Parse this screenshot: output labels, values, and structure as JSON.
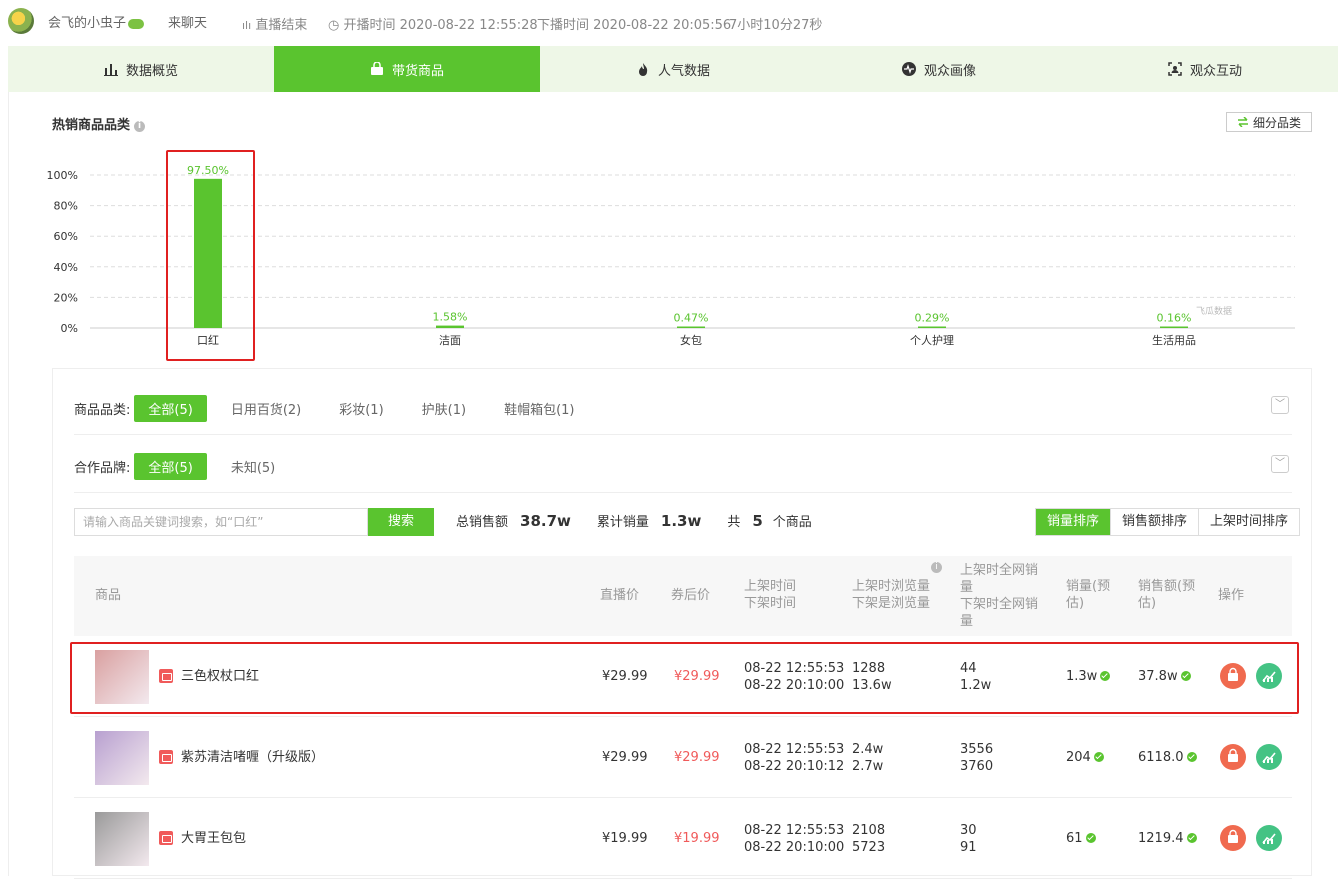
{
  "header": {
    "anchor_name": "会飞的小虫子",
    "chat_label": "来聊天",
    "live_status": "直播结束",
    "start_time": "开播时间 2020-08-22 12:55:28",
    "end_time": "下播时间 2020-08-22 20:05:56",
    "duration": "7小时10分27秒"
  },
  "tabs": [
    {
      "label": "数据概览",
      "icon": "bar-chart-icon",
      "active": false
    },
    {
      "label": "带货商品",
      "icon": "shopping-bag-icon",
      "active": true
    },
    {
      "label": "人气数据",
      "icon": "flame-icon",
      "active": false
    },
    {
      "label": "观众画像",
      "icon": "pulse-icon",
      "active": false
    },
    {
      "label": "观众互动",
      "icon": "face-scan-icon",
      "active": false
    }
  ],
  "category_section": {
    "title": "热销商品品类",
    "subcategory_button": "细分品类"
  },
  "watermark": "飞瓜数据",
  "chart_data": {
    "type": "bar",
    "title": "",
    "categories": [
      "口红",
      "洁面",
      "女包",
      "个人护理",
      "生活用品"
    ],
    "values": [
      97.5,
      1.58,
      0.47,
      0.29,
      0.16
    ],
    "value_labels": [
      "97.50%",
      "1.58%",
      "0.47%",
      "0.29%",
      "0.16%"
    ],
    "yticks": [
      "0%",
      "20%",
      "40%",
      "60%",
      "80%",
      "100%"
    ],
    "ylim": [
      0,
      100
    ],
    "grid": true,
    "color": "#5ac42f",
    "label_color": "#5ac42f"
  },
  "filters": {
    "category_label": "商品品类:",
    "category_chips": [
      "全部(5)",
      "日用百货(2)",
      "彩妆(1)",
      "护肤(1)",
      "鞋帽箱包(1)"
    ],
    "brand_label": "合作品牌:",
    "brand_chips": [
      "全部(5)",
      "未知(5)"
    ]
  },
  "search": {
    "placeholder": "请输入商品关键词搜索，如“口红”",
    "button": "搜索"
  },
  "stats": {
    "total_sales_label": "总销售额",
    "total_sales": "38.7w",
    "cum_volume_label": "累计销量",
    "cum_volume": "1.3w",
    "count_prefix": "共",
    "count": "5",
    "count_suffix": "个商品"
  },
  "sort": [
    "销量排序",
    "销售额排序",
    "上架时间排序"
  ],
  "table": {
    "headers": {
      "product": "商品",
      "live_price": "直播价",
      "coupon_price": "券后价",
      "shelf_time_1": "上架时间",
      "shelf_time_2": "下架时间",
      "views_1": "上架时浏览量",
      "views_2": "下架是浏览量",
      "net_sales_1": "上架时全网销量",
      "net_sales_2": "下架时全网销量",
      "volume": "销量(预估)",
      "revenue": "销售额(预估)",
      "ops": "操作"
    },
    "rows": [
      {
        "name": "三色权杖口红",
        "live_price": "¥29.99",
        "coupon_price": "¥29.99",
        "on_time": "08-22 12:55:53",
        "off_time": "08-22 20:10:00",
        "views_on": "1288",
        "views_off": "13.6w",
        "net_on": "44",
        "net_off": "1.2w",
        "volume": "1.3w",
        "revenue": "37.8w",
        "thumb_color": "#d9a0a0"
      },
      {
        "name": "紫苏清洁啫喱（升级版）",
        "live_price": "¥29.99",
        "coupon_price": "¥29.99",
        "on_time": "08-22 12:55:53",
        "off_time": "08-22 20:10:12",
        "views_on": "2.4w",
        "views_off": "2.7w",
        "net_on": "3556",
        "net_off": "3760",
        "volume": "204",
        "revenue": "6118.0",
        "thumb_color": "#b8a0d0"
      },
      {
        "name": "大胃王包包",
        "live_price": "¥19.99",
        "coupon_price": "¥19.99",
        "on_time": "08-22 12:55:53",
        "off_time": "08-22 20:10:00",
        "views_on": "2108",
        "views_off": "5723",
        "net_on": "30",
        "net_off": "91",
        "volume": "61",
        "revenue": "1219.4",
        "thumb_color": "#9a9a9a"
      }
    ]
  }
}
